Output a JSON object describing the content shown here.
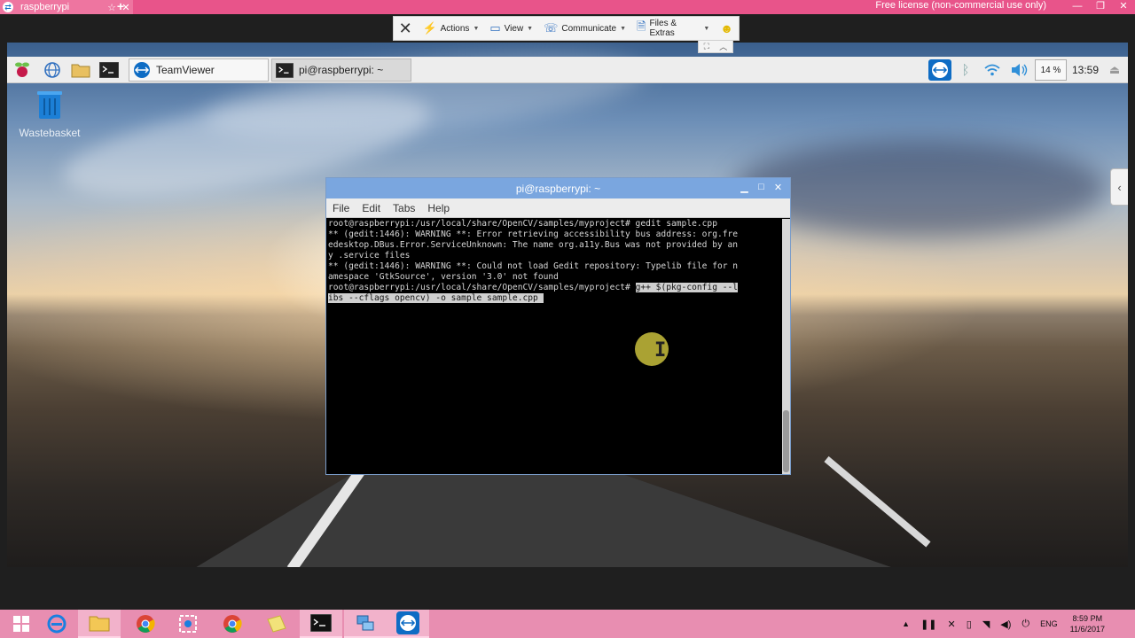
{
  "tv": {
    "tab_label": "raspberrypi",
    "license": "Free license (non-commercial use only)",
    "toolbar": {
      "actions": "Actions",
      "view": "View",
      "communicate": "Communicate",
      "files_extras": "Files & Extras"
    }
  },
  "pi": {
    "panel": {
      "tasks": [
        {
          "label": "TeamViewer"
        },
        {
          "label": "pi@raspberrypi: ~"
        }
      ],
      "cpu": "14 %",
      "clock": "13:59"
    },
    "desktop": {
      "wastebasket": "Wastebasket"
    },
    "terminal": {
      "title": "pi@raspberrypi: ~",
      "menu": [
        "File",
        "Edit",
        "Tabs",
        "Help"
      ],
      "lines": [
        "root@raspberrypi:/usr/local/share/OpenCV/samples/myproject# gedit sample.cpp",
        "",
        "** (gedit:1446): WARNING **: Error retrieving accessibility bus address: org.fre",
        "edesktop.DBus.Error.ServiceUnknown: The name org.a11y.Bus was not provided by an",
        "y .service files",
        "",
        "** (gedit:1446): WARNING **: Could not load Gedit repository: Typelib file for n",
        "amespace 'GtkSource', version '3.0' not found"
      ],
      "prompt": "root@raspberrypi:/usr/local/share/OpenCV/samples/myproject# ",
      "cmd_line1": "g++ $(pkg-config --l",
      "cmd_line2": "ibs --cflags opencv) -o sample sample.cpp "
    }
  },
  "windows": {
    "tray": {
      "lang": "ENG",
      "time": "8:59 PM",
      "date": "11/6/2017"
    }
  }
}
